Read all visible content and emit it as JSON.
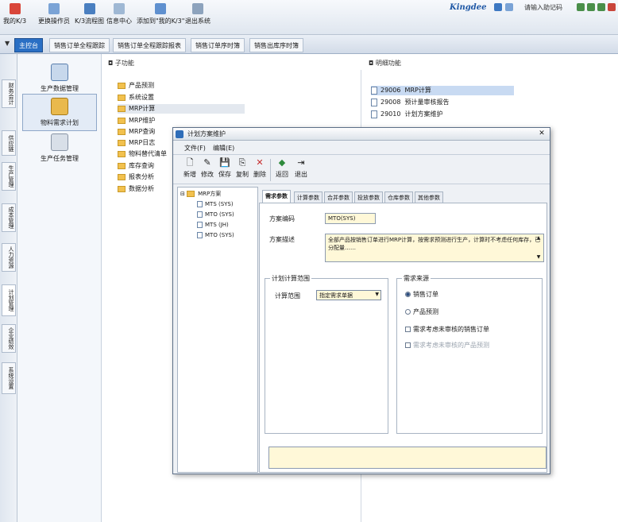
{
  "toolbar": {
    "buttons": [
      {
        "label": "我的K/3",
        "icon": "home-icon"
      },
      {
        "label": "更换操作员",
        "icon": "user-switch-icon"
      },
      {
        "label": "K/3流程图",
        "icon": "flowchart-icon"
      },
      {
        "label": "信息中心",
        "icon": "info-center-icon"
      },
      {
        "label": "添加到\"我的K/3\"",
        "icon": "add-favorite-icon"
      },
      {
        "label": "退出系统",
        "icon": "exit-icon"
      }
    ],
    "brand": "Kingdee",
    "user_info": "请输入助记码"
  },
  "tabs": {
    "console": "主控台",
    "items": [
      "销售订单全程跟踪",
      "销售订单全程跟踪报表",
      "销售订单序时簿",
      "销售出库序时簿"
    ]
  },
  "vertical_nav": [
    "财务会计",
    "供应链",
    "生产管理",
    "成本管理",
    "人力资源",
    "计划管理",
    "企业绩效",
    "系统设置"
  ],
  "modules": [
    {
      "label": "生产数据管理",
      "icon": "production-data-icon"
    },
    {
      "label": "物料需求计划",
      "icon": "mrp-icon",
      "selected": true
    },
    {
      "label": "生产任务管理",
      "icon": "production-task-icon"
    }
  ],
  "subpanel": {
    "title": "子功能",
    "items": [
      "产品预测",
      "系统设置",
      "MRP计算",
      "MRP维护",
      "MRP查询",
      "MRP日志",
      "物料替代清单",
      "库存查询",
      "报表分析",
      "数据分析"
    ],
    "highlighted": 2
  },
  "detail": {
    "title": "明细功能",
    "rows": [
      {
        "code": "29006",
        "label": "MRP计算",
        "selected": true
      },
      {
        "code": "29008",
        "label": "预计量审核报告"
      },
      {
        "code": "29010",
        "label": "计划方案维护"
      }
    ]
  },
  "dialog": {
    "title": "计划方案维护",
    "menu": [
      "文件(F)",
      "编辑(E)"
    ],
    "tools": [
      {
        "label": "新增",
        "icon": "new-icon",
        "glyph": "🗋"
      },
      {
        "label": "修改",
        "icon": "edit-icon",
        "glyph": "✎"
      },
      {
        "label": "保存",
        "icon": "save-icon",
        "glyph": "💾"
      },
      {
        "label": "复制",
        "icon": "copy-icon",
        "glyph": "⎘"
      },
      {
        "label": "删除",
        "icon": "delete-icon",
        "glyph": "✕"
      },
      {
        "label": "返回",
        "icon": "back-icon",
        "glyph": "◆"
      },
      {
        "label": "退出",
        "icon": "exit-icon",
        "glyph": "⇥"
      }
    ],
    "tree": {
      "root": "MRP方案",
      "children": [
        "MTS (SYS)",
        "MTO (SYS)",
        "MTS (JH)",
        "MTO (SYS)"
      ]
    },
    "tabs": [
      "需求参数",
      "计算参数",
      "合并参数",
      "投放参数",
      "仓库参数",
      "其他参数"
    ],
    "active_tab": 0,
    "form": {
      "code_label": "方案编码",
      "code_value": "MTO(SYS)",
      "desc_label": "方案描述",
      "desc_value": "全部产品按销售订单进行MRP计算，按需求预测进行生产，计算时不考虑任何库存，已分配量……",
      "calc_group": "计划计算范围",
      "calc_label": "计算范围",
      "calc_value": "指定需求单据",
      "source_group": "需求来源",
      "source_options": [
        {
          "label": "销售订单",
          "selected": true
        },
        {
          "label": "产品预测",
          "selected": false
        }
      ],
      "check1": "需求考虑未审核的销售订单",
      "check2": "需求考虑未审核的产品预测"
    }
  },
  "colors": {
    "accent": "#2a6fc4",
    "input_bg": "#fff8d8",
    "highlight": "#c8daf2"
  }
}
